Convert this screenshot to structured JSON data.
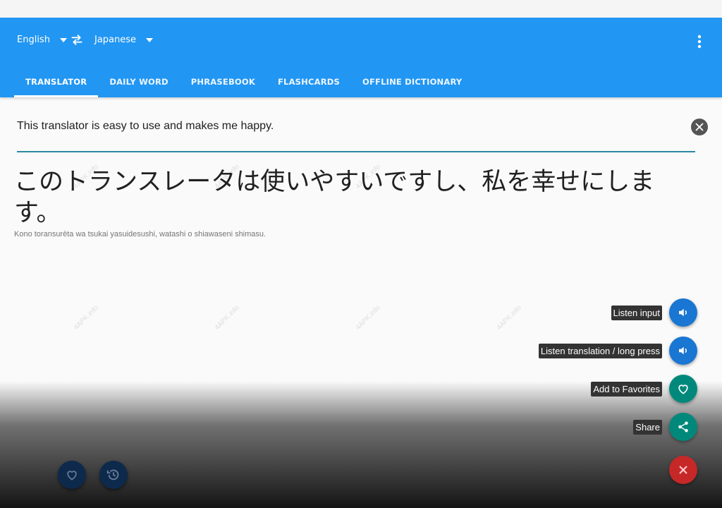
{
  "app_bar": {
    "source_language": "English",
    "target_language": "Japanese",
    "swap_icon": "swap-arrows",
    "menu_icon": "more-vert",
    "color": "#2196f3"
  },
  "tabs": [
    {
      "label": "TRANSLATOR",
      "active": true
    },
    {
      "label": "DAILY WORD",
      "active": false
    },
    {
      "label": "PHRASEBOOK",
      "active": false
    },
    {
      "label": "FLASHCARDS",
      "active": false
    },
    {
      "label": "OFFLINE DICTIONARY",
      "active": false
    }
  ],
  "translator": {
    "input_text": "This translator is easy to use and makes me happy.",
    "translation": "このトランスレータは使いやすいですし、私を幸せにします。",
    "romanization": "Kono toransurēta wa tsukai yasuidesushi, watashi o shiawaseni shimasu."
  },
  "fab_menu": {
    "listen_input": "Listen input",
    "listen_translation": "Listen translation / long press",
    "add_favorites": "Add to Favorites",
    "share": "Share"
  },
  "watermark": "4APK.info",
  "colors": {
    "accent": "#2196f3",
    "fab_blue": "#1976d2",
    "fab_teal": "#00897b",
    "fab_close": "#c62828",
    "divider": "#2a8a9e"
  }
}
